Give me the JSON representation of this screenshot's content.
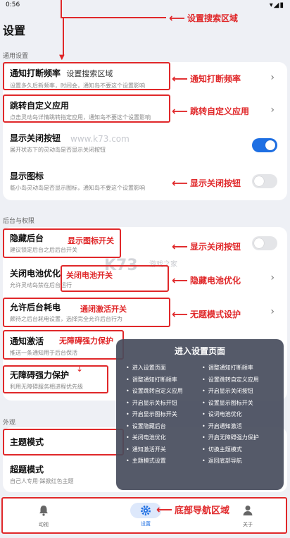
{
  "status_bar": {
    "time": "0:56",
    "icons": "▾◢▮"
  },
  "page_title": "设置",
  "top_annotation": "设置搜索区域",
  "sections": {
    "general": "通用设置",
    "background": "后台与权限",
    "appearance": "外观"
  },
  "general_rows": [
    {
      "title": "通知打断频率",
      "title_suffix": "设置搜索区域",
      "sub": "设置多久后新频率，时间会，通知岛不要这个设置影响",
      "control": "chevron"
    },
    {
      "title": "跳转自定义应用",
      "sub": "点击灵动岛详情跳转指定应用，通知岛不要这个设置影响",
      "control": "chevron"
    },
    {
      "title": "显示关闭按钮",
      "sub": "展开状态下的灵动岛是否显示关闭按钮",
      "control": "toggle_on"
    },
    {
      "title": "显示图标",
      "sub": "临小岛灵动岛是否显示图标，通知岛不要这个设置影响",
      "control": "toggle_off"
    }
  ],
  "background_rows": [
    {
      "title": "隐藏后台",
      "sub": "建议锁定后台之后后台开关",
      "control": "toggle_off"
    },
    {
      "title": "关闭电池优化",
      "sub": "允许灵动岛禁在后台运行",
      "control": "chevron"
    },
    {
      "title": "允许后台耗电",
      "sub": "颇待之后台耗电设置，选择完全允许后台行为",
      "control": "chevron"
    },
    {
      "title": "通知激活",
      "sub": "推送一条通知用于后台保活",
      "control": "toggle_off"
    },
    {
      "title": "无障碍强力保护",
      "sub": "利用无障碍服务相进程优先级",
      "control": "none"
    }
  ],
  "appearance_rows": [
    {
      "title": "主题模式",
      "sub": ""
    },
    {
      "title": "超题模式",
      "sub": "自己人专用·踩掀红色主题"
    }
  ],
  "annotations": {
    "right_1": "通知打断频率",
    "right_2": "跳转自定义应用",
    "right_3": "显示关闭按钮",
    "right_4": "显示图标开关",
    "right_5": "显示关闭按钮",
    "right_6": "隐藏电池优化",
    "right_7": "无题模式设护",
    "inline_1": "显示图标开关",
    "inline_2": "关闭电池开关",
    "inline_3": "通闭激活开关",
    "inline_4": "无障碍强力保护"
  },
  "watermark": "www.k73.com",
  "watermark2": "游戏之家",
  "overlay": {
    "title": "进入设置页面",
    "items": [
      "进入设置页面",
      "调整通知打断频率",
      "调整通知打断频率",
      "设置跳转自定义应用",
      "设置跳转自定义应用",
      "开启显示关闭按钮",
      "开启显示关标开钮",
      "设置显示图标开关",
      "开启显示图标开关",
      "设词电池优化",
      "设置隐藏后台",
      "开启通知激活",
      "关闭电池优化",
      "开启无障碍强力保护",
      "通知激活开关",
      "切换主题模式",
      "主题模式设置",
      "返回底部导航"
    ]
  },
  "bottom_nav": {
    "items": [
      {
        "label": "动视",
        "icon": "bell-icon"
      },
      {
        "label": "设置",
        "icon": "gear-icon"
      },
      {
        "label": "关于",
        "icon": "person-icon"
      }
    ],
    "annotation": "底部导航区域"
  },
  "colors": {
    "accent": "#1e6fe3",
    "annotation_red": "#e0282a"
  }
}
